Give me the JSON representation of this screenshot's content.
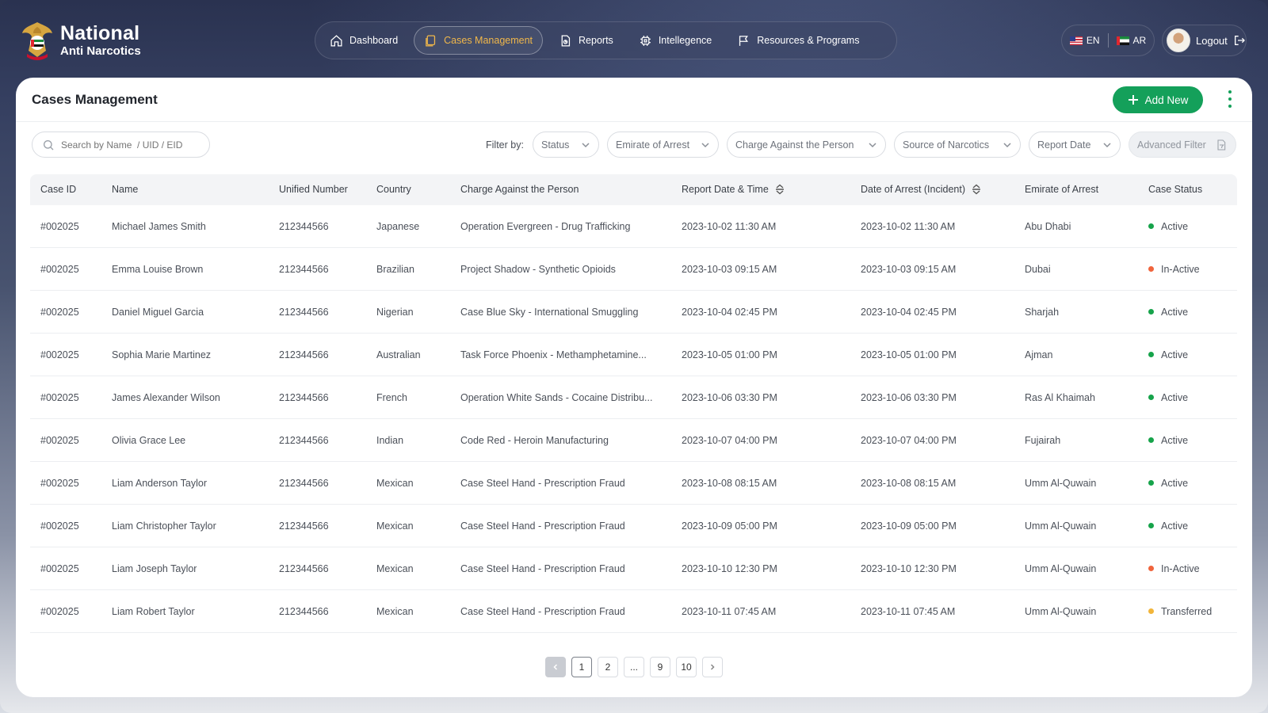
{
  "brand": {
    "line1": "National",
    "line2": "Anti Narcotics"
  },
  "nav": [
    {
      "label": "Dashboard",
      "icon": "home-icon",
      "active": false
    },
    {
      "label": "Cases Management",
      "icon": "document-icon",
      "active": true
    },
    {
      "label": "Reports",
      "icon": "report-icon",
      "active": false
    },
    {
      "label": "Intellegence",
      "icon": "chip-icon",
      "active": false
    },
    {
      "label": "Resources & Programs",
      "icon": "flag-icon",
      "active": false
    }
  ],
  "lang": {
    "en": "EN",
    "ar": "AR"
  },
  "user": {
    "logout_label": "Logout"
  },
  "page": {
    "title": "Cases Management",
    "add_label": "Add New"
  },
  "filters": {
    "search_placeholder": "Search by Name  / UID / EID",
    "filter_by_label": "Filter by:",
    "status": "Status",
    "emirate": "Emirate of Arrest",
    "charge": "Charge Against the Person",
    "source": "Source of Narcotics",
    "report_date": "Report Date",
    "advanced": "Advanced Filter"
  },
  "table": {
    "headers": {
      "case_id": "Case ID",
      "name": "Name",
      "unified": "Unified Number",
      "country": "Country",
      "charge": "Charge Against the Person",
      "report_dt": "Report Date & Time",
      "arrest_dt": "Date of Arrest (Incident)",
      "emirate": "Emirate of Arrest",
      "status": "Case Status"
    },
    "rows": [
      {
        "case_id": "#002025",
        "name": "Michael James Smith",
        "unified": "212344566",
        "country": "Japanese",
        "charge": "Operation Evergreen - Drug Trafficking",
        "report_dt": "2023-10-02 11:30 AM",
        "arrest_dt": "2023-10-02 11:30 AM",
        "emirate": "Abu Dhabi",
        "status": "Active"
      },
      {
        "case_id": "#002025",
        "name": "Emma Louise Brown",
        "unified": "212344566",
        "country": "Brazilian",
        "charge": "Project Shadow - Synthetic Opioids",
        "report_dt": "2023-10-03 09:15 AM",
        "arrest_dt": "2023-10-03 09:15 AM",
        "emirate": "Dubai",
        "status": "In-Active"
      },
      {
        "case_id": "#002025",
        "name": "Daniel Miguel Garcia",
        "unified": "212344566",
        "country": "Nigerian",
        "charge": "Case Blue Sky - International Smuggling",
        "report_dt": "2023-10-04 02:45 PM",
        "arrest_dt": "2023-10-04 02:45 PM",
        "emirate": "Sharjah",
        "status": "Active"
      },
      {
        "case_id": "#002025",
        "name": "Sophia Marie Martinez",
        "unified": "212344566",
        "country": "Australian",
        "charge": "Task Force Phoenix - Methamphetamine...",
        "report_dt": "2023-10-05 01:00 PM",
        "arrest_dt": "2023-10-05 01:00 PM",
        "emirate": "Ajman",
        "status": "Active"
      },
      {
        "case_id": "#002025",
        "name": "James Alexander Wilson",
        "unified": "212344566",
        "country": "French",
        "charge": "Operation White Sands - Cocaine Distribu...",
        "report_dt": "2023-10-06 03:30 PM",
        "arrest_dt": "2023-10-06 03:30 PM",
        "emirate": "Ras Al Khaimah",
        "status": "Active"
      },
      {
        "case_id": "#002025",
        "name": "Olivia Grace Lee",
        "unified": "212344566",
        "country": "Indian",
        "charge": "Code Red - Heroin Manufacturing",
        "report_dt": "2023-10-07 04:00 PM",
        "arrest_dt": "2023-10-07 04:00 PM",
        "emirate": "Fujairah",
        "status": "Active"
      },
      {
        "case_id": "#002025",
        "name": "Liam Anderson Taylor",
        "unified": "212344566",
        "country": "Mexican",
        "charge": "Case Steel Hand - Prescription Fraud",
        "report_dt": "2023-10-08 08:15 AM",
        "arrest_dt": "2023-10-08 08:15 AM",
        "emirate": "Umm Al-Quwain",
        "status": "Active"
      },
      {
        "case_id": "#002025",
        "name": "Liam Christopher Taylor",
        "unified": "212344566",
        "country": "Mexican",
        "charge": "Case Steel Hand - Prescription Fraud",
        "report_dt": "2023-10-09 05:00 PM",
        "arrest_dt": "2023-10-09 05:00 PM",
        "emirate": "Umm Al-Quwain",
        "status": "Active"
      },
      {
        "case_id": "#002025",
        "name": "Liam Joseph Taylor",
        "unified": "212344566",
        "country": "Mexican",
        "charge": "Case Steel Hand - Prescription Fraud",
        "report_dt": "2023-10-10 12:30 PM",
        "arrest_dt": "2023-10-10 12:30 PM",
        "emirate": "Umm Al-Quwain",
        "status": "In-Active"
      },
      {
        "case_id": "#002025",
        "name": "Liam Robert Taylor",
        "unified": "212344566",
        "country": "Mexican",
        "charge": "Case Steel Hand - Prescription Fraud",
        "report_dt": "2023-10-11 07:45 AM",
        "arrest_dt": "2023-10-11 07:45 AM",
        "emirate": "Umm Al-Quwain",
        "status": "Transferred"
      }
    ]
  },
  "status_colors": {
    "Active": "#16a34a",
    "In-Active": "#f0643c",
    "Transferred": "#f2b53a"
  },
  "pagination": [
    "1",
    "2",
    "...",
    "9",
    "10"
  ],
  "colors": {
    "accent": "#14a05a",
    "nav_active": "#f0b74a"
  }
}
